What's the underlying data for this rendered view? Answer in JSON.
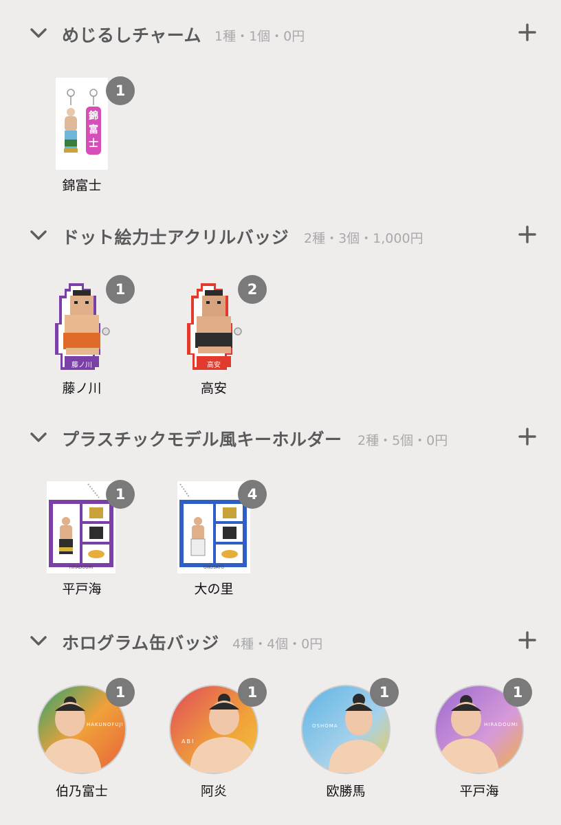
{
  "sections": [
    {
      "title": "めじるしチャーム",
      "meta": "1種・1個・0円",
      "items": [
        {
          "label": "錦富士",
          "count": "1",
          "thumb_text": "錦富士"
        }
      ]
    },
    {
      "title": "ドット絵力士アクリルバッジ",
      "meta": "2種・3個・1,000円",
      "items": [
        {
          "label": "藤ノ川",
          "count": "1",
          "tag": "藤ノ川",
          "color": "#7b3fa8"
        },
        {
          "label": "高安",
          "count": "2",
          "tag": "高安",
          "color": "#e23a2c"
        }
      ]
    },
    {
      "title": "プラスチックモデル風キーホルダー",
      "meta": "2種・5個・0円",
      "items": [
        {
          "label": "平戸海",
          "count": "1",
          "color": "#7b3fa8",
          "caption": "HIRADOUMI"
        },
        {
          "label": "大の里",
          "count": "4",
          "color": "#2f5fc4",
          "caption": "ONOSATO"
        }
      ]
    },
    {
      "title": "ホログラム缶バッジ",
      "meta": "4種・4個・0円",
      "items": [
        {
          "label": "伯乃富士",
          "count": "1",
          "bg1": "#f0a13a",
          "bg2": "#2ea36d",
          "caption": "HAKUNOFUJI"
        },
        {
          "label": "阿炎",
          "count": "1",
          "bg1": "#e04a5a",
          "bg2": "#f0a23a",
          "caption": "ABI"
        },
        {
          "label": "欧勝馬",
          "count": "1",
          "bg1": "#5fb4e6",
          "bg2": "#f3c83c",
          "caption": "OSHOMA"
        },
        {
          "label": "平戸海",
          "count": "1",
          "bg1": "#9b6ad0",
          "bg2": "#f0b03a",
          "caption": "HIRADOUMI"
        }
      ]
    }
  ],
  "icons": {
    "collapse": "chevron-down-icon",
    "add": "plus-icon"
  }
}
